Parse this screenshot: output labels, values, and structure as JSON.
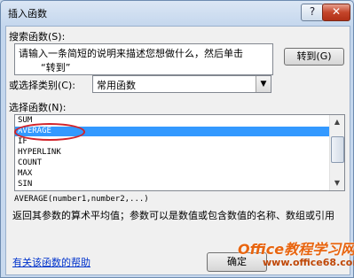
{
  "window": {
    "title": "插入函数",
    "help_glyph": "?",
    "close_glyph": "✕"
  },
  "search": {
    "label": "搜索函数(S):",
    "text_line1": "请输入一条简短的说明来描述您想做什么，然后单击",
    "text_line2": "“转到”",
    "go_button": "转到(G)"
  },
  "category": {
    "label": "或选择类别(C):",
    "value": "常用函数"
  },
  "functions": {
    "label": "选择函数(N):",
    "items": [
      "SUM",
      "AVERAGE",
      "IF",
      "HYPERLINK",
      "COUNT",
      "MAX",
      "SIN"
    ],
    "selected": "AVERAGE"
  },
  "syntax": "AVERAGE(number1,number2,...)",
  "description": "返回其参数的算术平均值；参数可以是数值或包含数值的名称、数组或引用",
  "help_link": "有关该函数的帮助",
  "ok_button": "确定",
  "watermark": {
    "line1": "Office教程学习网",
    "line2": "www.office68.com"
  }
}
